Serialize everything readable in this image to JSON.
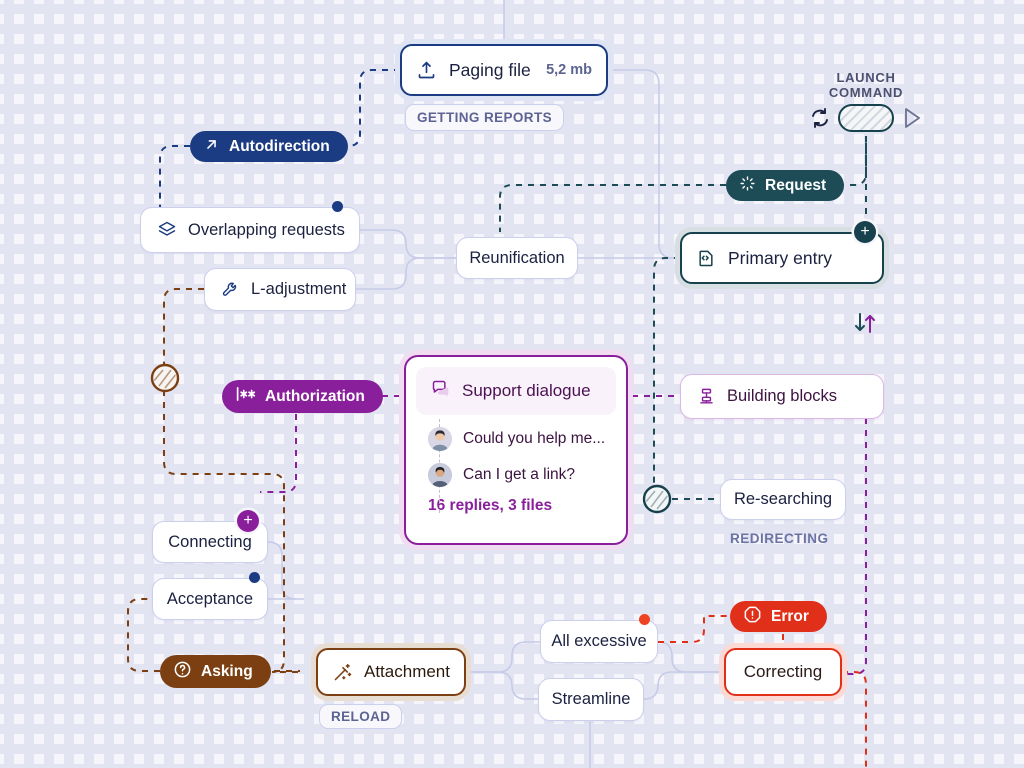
{
  "board": {
    "background_color": "#f5f5fb",
    "grid_color": "#e3e4f2"
  },
  "nodes": [
    {
      "id": "paging-file",
      "label": "Paging file",
      "meta": "5,2 mb",
      "icon": "upload-icon",
      "style": "navy-selected",
      "caption_chip": "GETTING REPORTS"
    },
    {
      "id": "overlapping-requests",
      "label": "Overlapping requests",
      "icon": "layers-icon",
      "style": "plain",
      "badge": "navy-dot"
    },
    {
      "id": "l-adjustment",
      "label": "L-adjustment",
      "icon": "wrench-icon",
      "style": "plain"
    },
    {
      "id": "reunification",
      "label": "Reunification",
      "style": "plain"
    },
    {
      "id": "primary-entry",
      "label": "Primary entry",
      "icon": "code-file-icon",
      "style": "teal-selected",
      "badge": "teal-plus"
    },
    {
      "id": "building-blocks",
      "label": "Building blocks",
      "icon": "blocks-icon",
      "style": "purple-outline"
    },
    {
      "id": "re-searching",
      "label": "Re-searching",
      "style": "plain",
      "caption": "REDIRECTING"
    },
    {
      "id": "connecting",
      "label": "Connecting",
      "style": "plain",
      "badge": "purple-plus"
    },
    {
      "id": "acceptance",
      "label": "Acceptance",
      "style": "plain",
      "badge": "navy-dot"
    },
    {
      "id": "attachment",
      "label": "Attachment",
      "icon": "magic-wand-icon",
      "style": "brown-selected",
      "caption_chip": "RELOAD"
    },
    {
      "id": "all-excessive",
      "label": "All excessive",
      "style": "plain",
      "badge": "red-dot"
    },
    {
      "id": "streamline",
      "label": "Streamline",
      "style": "plain"
    },
    {
      "id": "correcting",
      "label": "Correcting",
      "style": "red-selected"
    }
  ],
  "pills": [
    {
      "id": "autodirection",
      "label": "Autodirection",
      "icon": "arrow-up-right-icon",
      "color": "#1b3b82"
    },
    {
      "id": "request",
      "label": "Request",
      "icon": "spinner-icon",
      "color": "#1d4c57"
    },
    {
      "id": "authorization",
      "label": "Authorization",
      "icon": "password-dots-icon",
      "color": "#8a1f9c"
    },
    {
      "id": "asking",
      "label": "Asking",
      "icon": "question-circle-icon",
      "color": "#7b3f12"
    },
    {
      "id": "error",
      "label": "Error",
      "icon": "alert-octagon-icon",
      "color": "#e0301a"
    }
  ],
  "support_dialogue": {
    "title": "Support dialogue",
    "icon": "chat-bubbles-icon",
    "messages": [
      {
        "avatar": "user-avatar-1",
        "text": "Could you help me..."
      },
      {
        "avatar": "user-avatar-2",
        "text": "Can I get a link?"
      }
    ],
    "replies_summary": "16 replies, 3 files",
    "accent_color": "#8a1f9c"
  },
  "launch_command": {
    "label_line1": "LAUNCH",
    "label_line2": "COMMAND",
    "refresh_icon": "refresh-icon",
    "play_icon": "play-icon",
    "pill_icon": "hatched-pill"
  },
  "swap_icon": {
    "name": "sort-updown-icon",
    "down_color": "#1d4c57",
    "up_color": "#8a1f9c"
  },
  "connectors": [
    {
      "id": "solid-edges",
      "color": "#c6cbe8",
      "style": "solid"
    },
    {
      "id": "navy-dashed",
      "color": "#1b3b82",
      "style": "dashed"
    },
    {
      "id": "teal-dashed",
      "color": "#1d4c57",
      "style": "dashed"
    },
    {
      "id": "purple-dashed",
      "color": "#8a1f9c",
      "style": "dashed"
    },
    {
      "id": "brown-dashed",
      "color": "#7b3f12",
      "style": "dashed"
    },
    {
      "id": "red-dashed",
      "color": "#e0301a",
      "style": "dashed"
    }
  ],
  "hatched_connectors": [
    {
      "id": "brown-hatch-node",
      "color": "#7b3f12"
    },
    {
      "id": "teal-hatch-node",
      "color": "#17414c"
    }
  ]
}
